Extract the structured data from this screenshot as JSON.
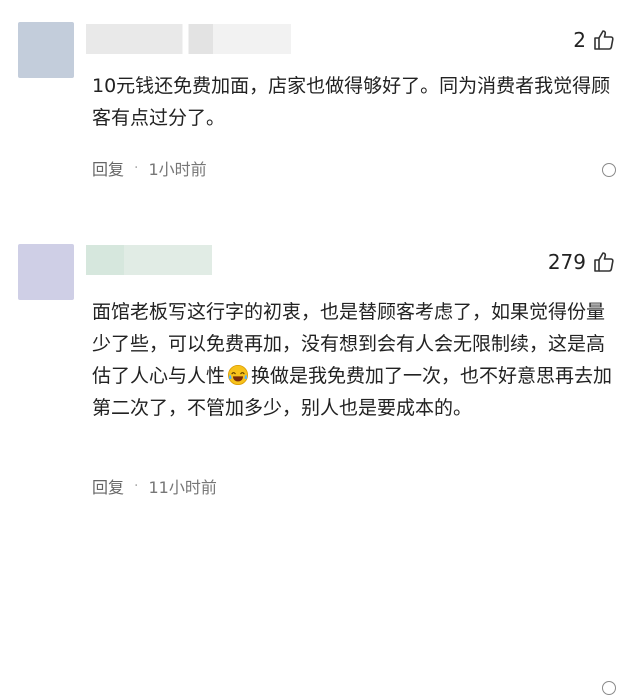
{
  "comments": [
    {
      "likes": "2",
      "text": "10元钱还免费加面，店家也做得够好了。同为消费者我觉得顾客有点过分了。",
      "reply_label": "回复",
      "separator": "·",
      "time": "1小时前"
    },
    {
      "likes": "279",
      "text_before_emoji": "面馆老板写这行字的初衷，也是替顾客考虑了，如果觉得份量少了些，可以免费再加，没有想到会有人会无限制续，这是高估了人心与人性",
      "emoji_icon": "laughing-crying-emoji",
      "text_after_emoji": "换做是我免费加了一次，也不好意思再去加第二次了，不管加多少，别人也是要成本的。",
      "reply_label": "回复",
      "separator": "·",
      "time": "11小时前"
    }
  ],
  "colors": {
    "avatar_1": "#c3cddb",
    "avatar_2": "#cfcfe6",
    "meta_text": "#777777"
  }
}
